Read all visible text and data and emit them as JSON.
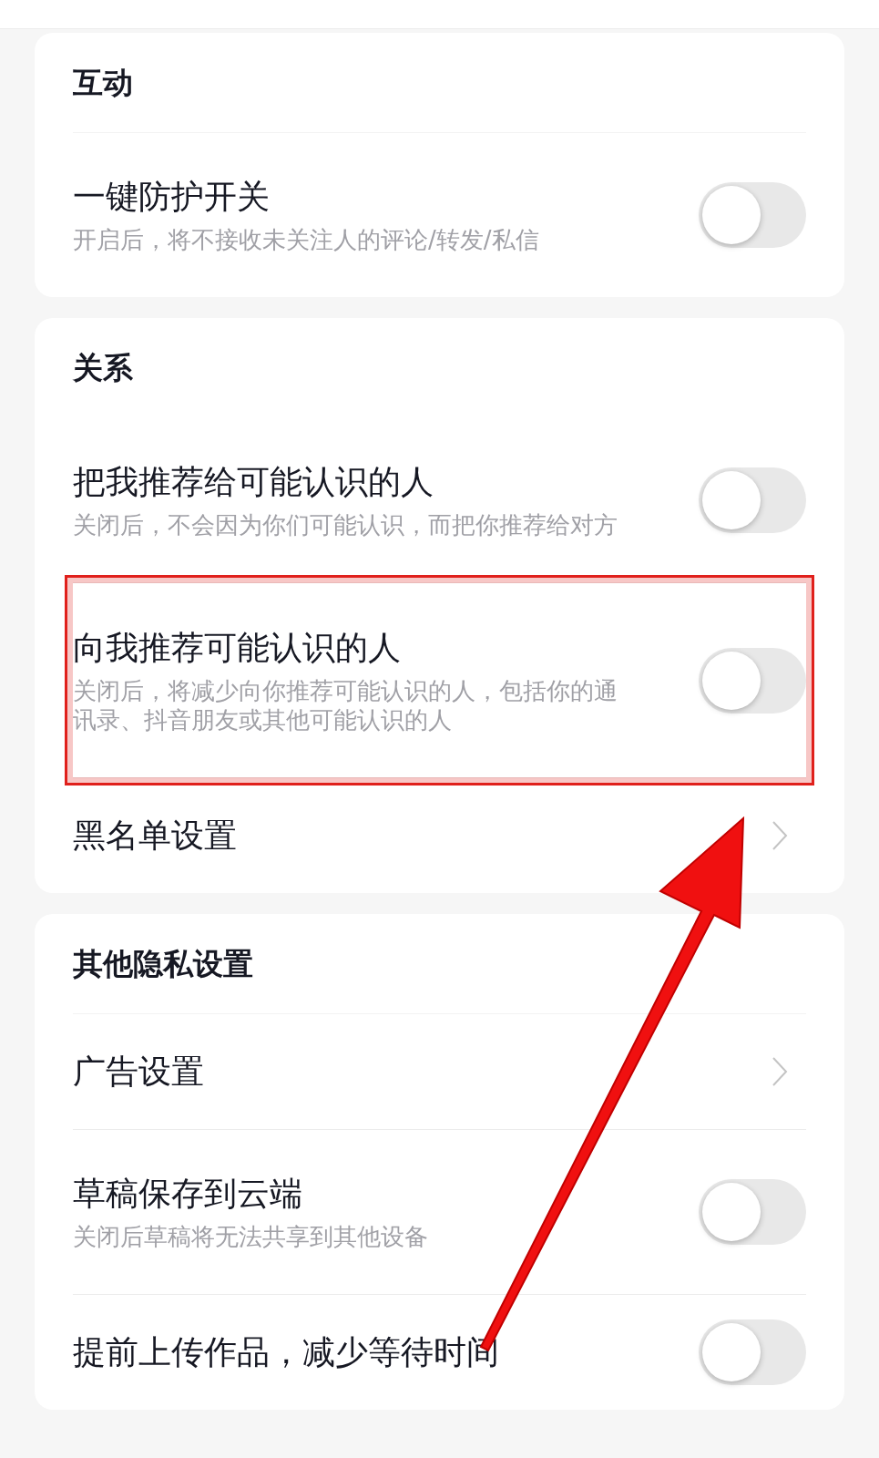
{
  "sections": [
    {
      "title": "互动",
      "items": [
        {
          "kind": "toggle",
          "label": "一键防护开关",
          "description": "开启后，将不接收未关注人的评论/转发/私信",
          "on": false,
          "highlighted": false
        }
      ]
    },
    {
      "title": "关系",
      "items": [
        {
          "kind": "toggle",
          "label": "把我推荐给可能认识的人",
          "description": "关闭后，不会因为你们可能认识，而把你推荐给对方",
          "on": false,
          "highlighted": false
        },
        {
          "kind": "toggle",
          "label": "向我推荐可能认识的人",
          "description": "关闭后，将减少向你推荐可能认识的人，包括你的通讯录、抖音朋友或其他可能认识的人",
          "on": false,
          "highlighted": true
        },
        {
          "kind": "link",
          "label": "黑名单设置",
          "highlighted": false
        }
      ]
    },
    {
      "title": "其他隐私设置",
      "items": [
        {
          "kind": "link",
          "label": "广告设置",
          "highlighted": false
        },
        {
          "kind": "toggle",
          "label": "草稿保存到云端",
          "description": "关闭后草稿将无法共享到其他设备",
          "on": false,
          "highlighted": false
        },
        {
          "kind": "toggle",
          "label": "提前上传作品，减少等待时间",
          "on": false,
          "highlighted": false
        }
      ]
    }
  ]
}
